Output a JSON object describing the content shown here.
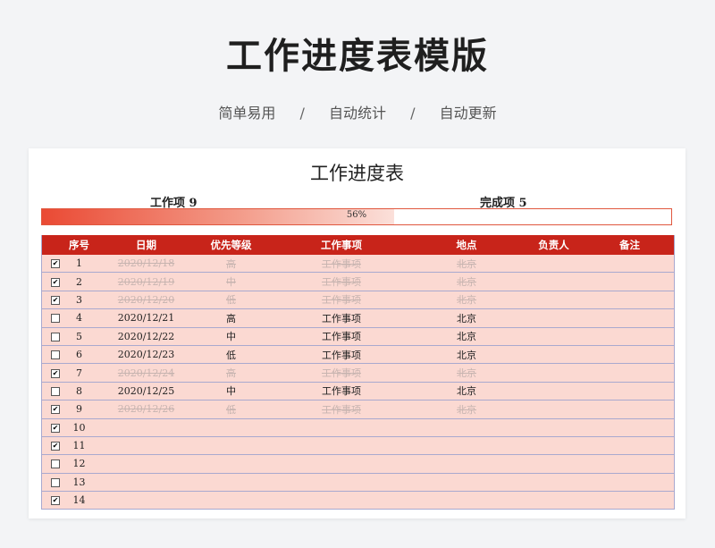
{
  "header": {
    "title": "工作进度表模版",
    "features": [
      "简单易用",
      "自动统计",
      "自动更新"
    ],
    "separator": "/"
  },
  "sheet": {
    "title": "工作进度表",
    "total_label": "工作项 9",
    "done_label": "完成项 5",
    "progress": {
      "value": 0.56,
      "text": "56%"
    },
    "columns": [
      "序号",
      "日期",
      "优先等级",
      "工作事项",
      "地点",
      "负责人",
      "备注"
    ],
    "rows": [
      {
        "checked": true,
        "no": "1",
        "date": "2020/12/18",
        "priority": "高",
        "task": "工作事项",
        "location": "北京",
        "owner": "",
        "note": ""
      },
      {
        "checked": true,
        "no": "2",
        "date": "2020/12/19",
        "priority": "中",
        "task": "工作事项",
        "location": "北京",
        "owner": "",
        "note": ""
      },
      {
        "checked": true,
        "no": "3",
        "date": "2020/12/20",
        "priority": "低",
        "task": "工作事项",
        "location": "北京",
        "owner": "",
        "note": ""
      },
      {
        "checked": false,
        "no": "4",
        "date": "2020/12/21",
        "priority": "高",
        "task": "工作事项",
        "location": "北京",
        "owner": "",
        "note": ""
      },
      {
        "checked": false,
        "no": "5",
        "date": "2020/12/22",
        "priority": "中",
        "task": "工作事项",
        "location": "北京",
        "owner": "",
        "note": ""
      },
      {
        "checked": false,
        "no": "6",
        "date": "2020/12/23",
        "priority": "低",
        "task": "工作事项",
        "location": "北京",
        "owner": "",
        "note": ""
      },
      {
        "checked": true,
        "no": "7",
        "date": "2020/12/24",
        "priority": "高",
        "task": "工作事项",
        "location": "北京",
        "owner": "",
        "note": ""
      },
      {
        "checked": false,
        "no": "8",
        "date": "2020/12/25",
        "priority": "中",
        "task": "工作事项",
        "location": "北京",
        "owner": "",
        "note": ""
      },
      {
        "checked": true,
        "no": "9",
        "date": "2020/12/26",
        "priority": "低",
        "task": "工作事项",
        "location": "北京",
        "owner": "",
        "note": ""
      },
      {
        "checked": true,
        "no": "10",
        "date": "",
        "priority": "",
        "task": "",
        "location": "",
        "owner": "",
        "note": ""
      },
      {
        "checked": true,
        "no": "11",
        "date": "",
        "priority": "",
        "task": "",
        "location": "",
        "owner": "",
        "note": ""
      },
      {
        "checked": false,
        "no": "12",
        "date": "",
        "priority": "",
        "task": "",
        "location": "",
        "owner": "",
        "note": ""
      },
      {
        "checked": false,
        "no": "13",
        "date": "",
        "priority": "",
        "task": "",
        "location": "",
        "owner": "",
        "note": ""
      },
      {
        "checked": true,
        "no": "14",
        "date": "",
        "priority": "",
        "task": "",
        "location": "",
        "owner": "",
        "note": ""
      }
    ]
  },
  "colors": {
    "header_bg": "#c8241a",
    "row_bg": "#fbd9d2",
    "grid_line": "#a9a9cf",
    "progress_start": "#ea4a34"
  },
  "icons": {
    "checkbox_checked": "check-mark-icon"
  }
}
